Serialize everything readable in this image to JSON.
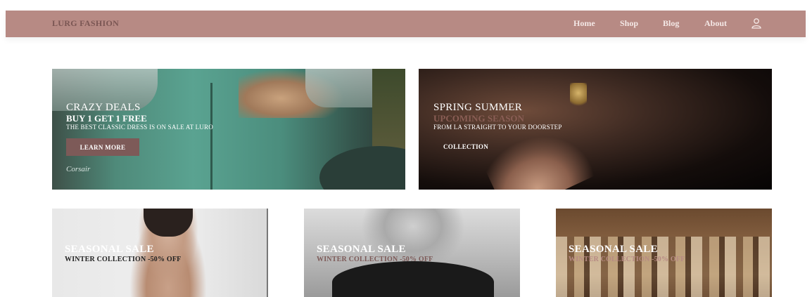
{
  "navbar": {
    "brand": "LURG FASHION",
    "links": [
      "Home",
      "Shop",
      "Blog",
      "About"
    ],
    "user_icon": "user-icon"
  },
  "banners": [
    {
      "title": "CRAZY DEALS",
      "subtitle": "BUY 1 GET 1 FREE",
      "caption": "THE BEST CLASSIC DRESS IS ON SALE AT LURO",
      "button_label": "LEARN MORE",
      "script_text": "Corsair"
    },
    {
      "title": "SPRING SUMMER",
      "subtitle": "UPCOMING SEASON",
      "caption": "FROM LA STRAIGHT TO YOUR DOORSTEP",
      "button_label": "COLLECTION"
    }
  ],
  "sale_cards": [
    {
      "title": "SEASONAL SALE",
      "subtitle": "WINTER COLLECTION -50% OFF"
    },
    {
      "title": "SEASONAL SALE",
      "subtitle": "WINTER COLLECTION -50% OFF"
    },
    {
      "title": "SEASONAL SALE",
      "subtitle": "WINTER COLLECTION -50% OFF"
    }
  ],
  "colors": {
    "navbar_bg": "#b78a84",
    "brand_text": "#7a5653",
    "button_bg": "#7d5a58"
  }
}
